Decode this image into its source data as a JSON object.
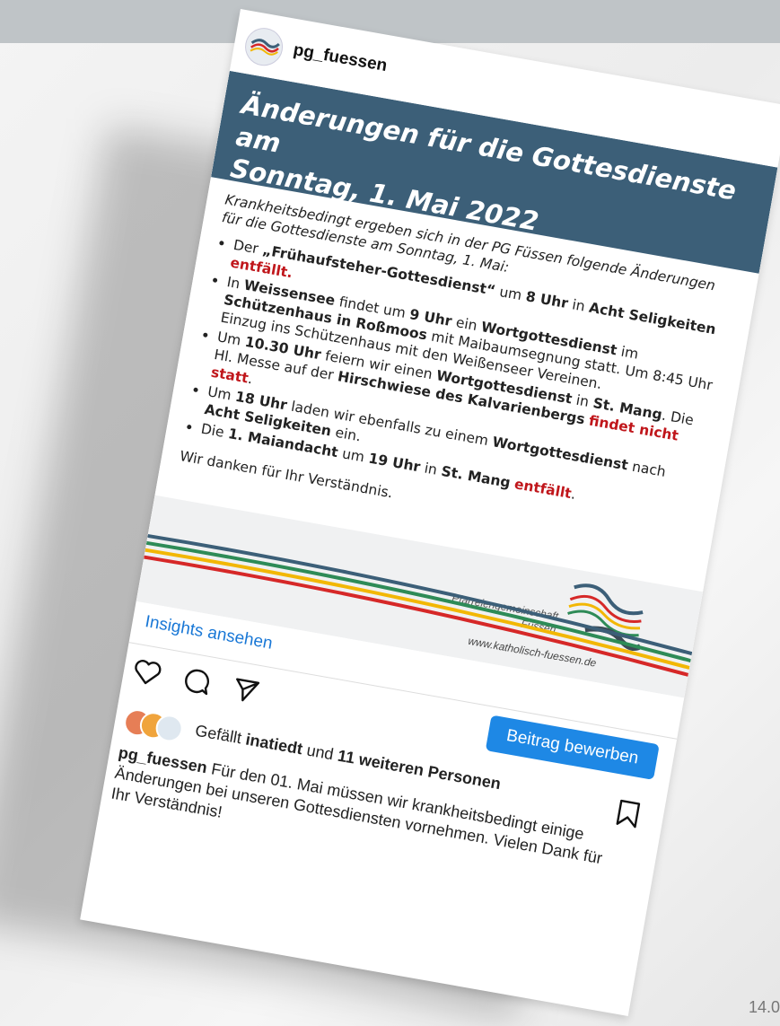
{
  "instagram": {
    "username": "pg_fuessen",
    "menu_icon": "more-vertical-icon",
    "insights_link": "Insights ansehen",
    "promote_button": "Beitrag bewerben",
    "likes": {
      "prefix": "Gefällt",
      "user": "inatiedt",
      "mid": "und",
      "others": "11 weiteren Personen"
    },
    "caption": {
      "username": "pg_fuessen",
      "text": "Für den 01. Mai müssen wir krankheitsbedingt einige Änderungen bei unseren Gottesdiensten vornehmen. Vielen Dank für Ihr Verständnis!"
    }
  },
  "post": {
    "title_line1": "Änderungen für die Gottesdienste am",
    "title_line2": "Sonntag, 1. Mai 2022",
    "intro": "Krankheitsbedingt ergeben sich in der PG Füssen folgende Änderungen für die Gottesdienste am Sonntag, 1. Mai:",
    "item1": {
      "a": "Der ",
      "b": "„Frühaufsteher-Gottesdienst“",
      "c": " um ",
      "d": "8 Uhr",
      "e": " in ",
      "f": "Acht Seligkeiten",
      "g": "entfällt."
    },
    "item2": {
      "a": "In ",
      "b": "Weissensee",
      "c": " findet um ",
      "d": "9 Uhr",
      "e": " ein ",
      "f": "Wortgottesdienst",
      "g": " im ",
      "h": "Schützenhaus in Roßmoos",
      "i": " mit Maibaumsegnung statt.",
      "j": "Um 8:45 Uhr Einzug ins Schützenhaus mit den Weißenseer Vereinen."
    },
    "item3": {
      "a": "Um ",
      "b": "10.30 Uhr",
      "c": " feiern wir einen ",
      "d": "Wortgottesdienst",
      "e": " in ",
      "f": "St. Mang",
      "g": ".",
      "h": "Die Hl. Messe auf der ",
      "i": "Hirschwiese des Kalvarienbergs",
      "j": "findet nicht statt",
      "k": "."
    },
    "item4": {
      "a": "Um ",
      "b": "18 Uhr",
      "c": " laden wir ebenfalls zu einem ",
      "d": "Wortgottesdienst",
      "e": " nach ",
      "f": "Acht Seligkeiten",
      "g": " ein."
    },
    "item5": {
      "a": "Die ",
      "b": "1. Maiandacht",
      "c": " um ",
      "d": "19 Uhr",
      "e": " in ",
      "f": "St. Mang",
      "g": " ",
      "h": "entfällt",
      "i": "."
    },
    "thanks": "Wir danken für Ihr Verständnis.",
    "brand_line1": "Pfarreiengemeinschaft",
    "brand_line2": "Füssen",
    "website": "www.katholisch-fuessen.de"
  },
  "slide": {
    "date": "14.0"
  },
  "colors": {
    "banner": "#3c5f78",
    "link": "#1877d6",
    "button": "#1e88e5",
    "accent_red": "#c0161b"
  }
}
